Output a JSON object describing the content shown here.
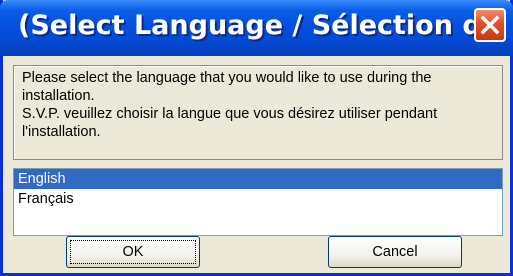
{
  "window": {
    "title": "(Select Language / Sélection d..",
    "close_icon": "close-icon"
  },
  "message": {
    "line_en": "Please select the language that you would like to use during the installation.",
    "line_fr": "S.V.P. veuillez choisir la langue que vous désirez utiliser pendant l'installation."
  },
  "languages": {
    "items": [
      {
        "label": "English",
        "selected": true
      },
      {
        "label": "Français",
        "selected": false
      }
    ],
    "selection_color": "#316ac5"
  },
  "buttons": {
    "ok_label": "OK",
    "cancel_label": "Cancel"
  },
  "colors": {
    "titlebar": "#0552e0",
    "close_button": "#e0502a",
    "dialog_bg": "#ece9d8"
  }
}
